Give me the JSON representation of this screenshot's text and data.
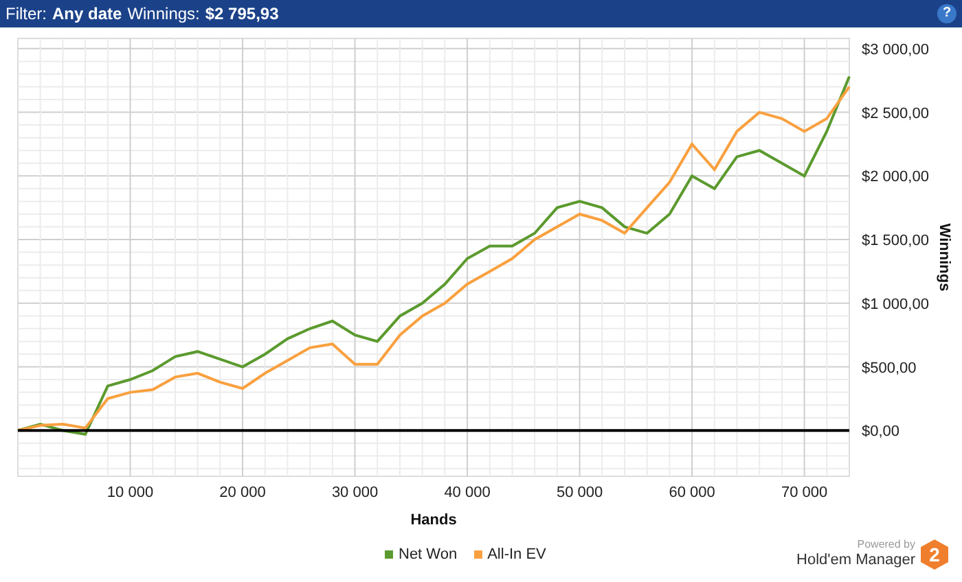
{
  "header": {
    "filter_label": "Filter:",
    "filter_value": "Any date",
    "winnings_label": "Winnings:",
    "winnings_value": "$2 795,93",
    "help_glyph": "?"
  },
  "chart": {
    "chart_data": {
      "type": "line",
      "grid": true,
      "xlabel": "Hands",
      "ylabel": "Winnings",
      "xlim": [
        0,
        74000
      ],
      "ylim": [
        -360,
        3080
      ],
      "xticks": [
        {
          "value": 10000,
          "label": "10 000"
        },
        {
          "value": 20000,
          "label": "20 000"
        },
        {
          "value": 30000,
          "label": "30 000"
        },
        {
          "value": 40000,
          "label": "40 000"
        },
        {
          "value": 50000,
          "label": "50 000"
        },
        {
          "value": 60000,
          "label": "60 000"
        },
        {
          "value": 70000,
          "label": "70 000"
        }
      ],
      "yticks": [
        {
          "value": 0,
          "label": "$0,00"
        },
        {
          "value": 500,
          "label": "$500,00"
        },
        {
          "value": 1000,
          "label": "$1 000,00"
        },
        {
          "value": 1500,
          "label": "$1 500,00"
        },
        {
          "value": 2000,
          "label": "$2 000,00"
        },
        {
          "value": 2500,
          "label": "$2 500,00"
        },
        {
          "value": 3000,
          "label": "$3 000,00"
        }
      ],
      "x": [
        0,
        2000,
        4000,
        6000,
        8000,
        10000,
        12000,
        14000,
        16000,
        18000,
        20000,
        22000,
        24000,
        26000,
        28000,
        30000,
        32000,
        34000,
        36000,
        38000,
        40000,
        42000,
        44000,
        46000,
        48000,
        50000,
        52000,
        54000,
        56000,
        58000,
        60000,
        62000,
        64000,
        66000,
        68000,
        70000,
        72000,
        74000
      ],
      "series": [
        {
          "name": "Net Won",
          "color": "#5b9a2e",
          "values": [
            0,
            50,
            0,
            -30,
            350,
            400,
            470,
            580,
            620,
            560,
            500,
            600,
            720,
            800,
            860,
            750,
            700,
            900,
            1000,
            1150,
            1350,
            1450,
            1450,
            1550,
            1750,
            1800,
            1750,
            1600,
            1550,
            1700,
            2000,
            1900,
            2150,
            2200,
            2100,
            2000,
            2350,
            2780
          ]
        },
        {
          "name": "All-In EV",
          "color": "#f9a03f",
          "values": [
            0,
            40,
            50,
            20,
            250,
            300,
            320,
            420,
            450,
            380,
            330,
            450,
            550,
            650,
            680,
            520,
            520,
            750,
            900,
            1000,
            1150,
            1250,
            1350,
            1500,
            1600,
            1700,
            1650,
            1550,
            1750,
            1950,
            2250,
            2050,
            2350,
            2500,
            2450,
            2350,
            2450,
            2700
          ]
        }
      ]
    }
  },
  "branding": {
    "powered_by": "Powered by",
    "product": "Hold'em Manager",
    "logo_glyph": "2"
  }
}
